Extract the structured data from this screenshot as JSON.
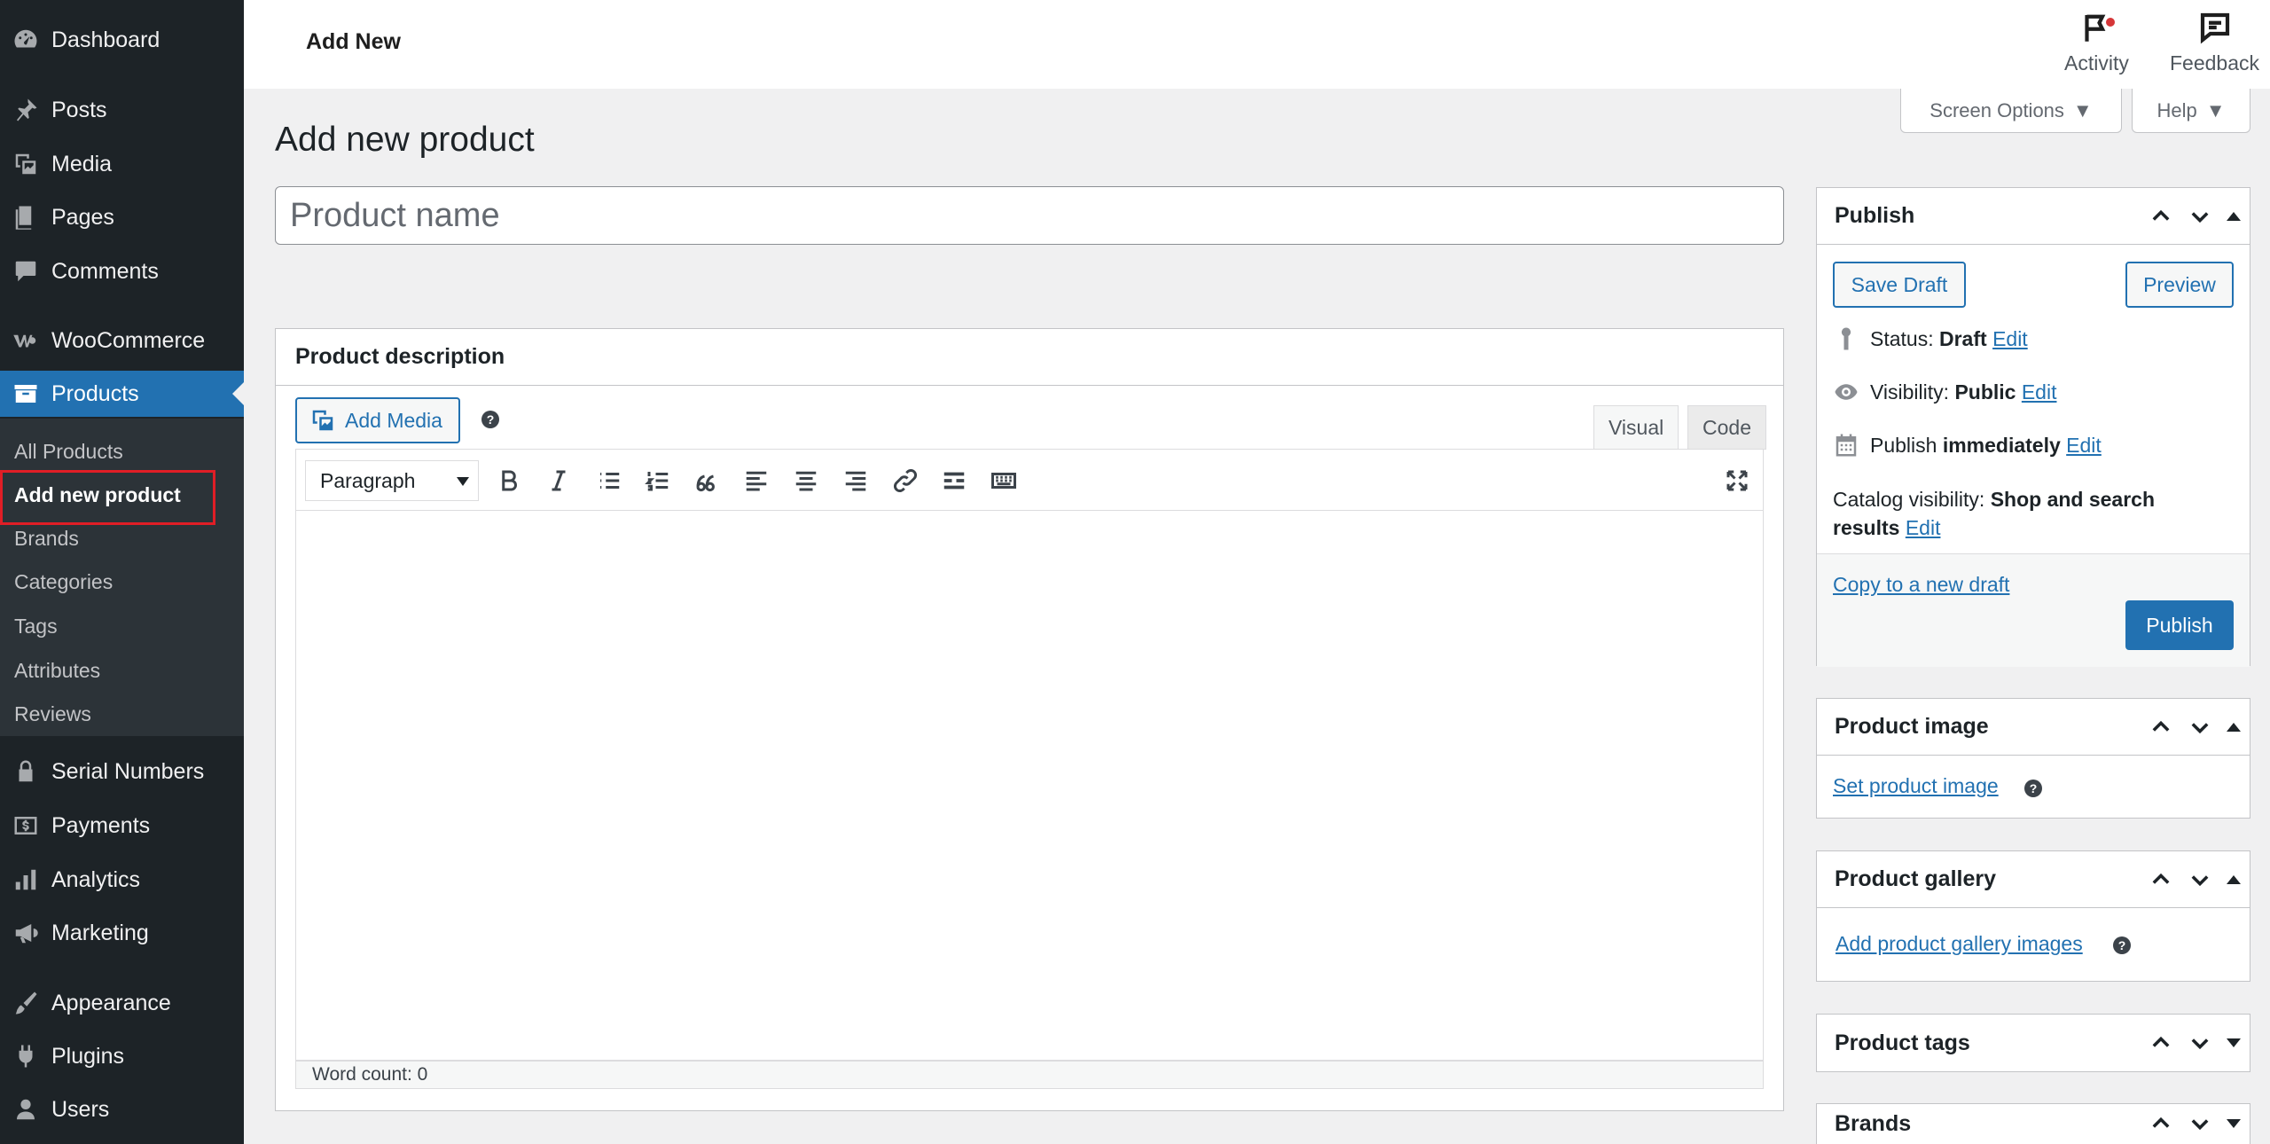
{
  "sidebar": {
    "items": [
      {
        "label": "Dashboard",
        "icon": "dashboard-icon"
      },
      {
        "label": "Posts",
        "icon": "pin-icon"
      },
      {
        "label": "Media",
        "icon": "media-icon"
      },
      {
        "label": "Pages",
        "icon": "pages-icon"
      },
      {
        "label": "Comments",
        "icon": "comment-icon"
      },
      {
        "label": "WooCommerce",
        "icon": "woocommerce-icon"
      },
      {
        "label": "Products",
        "icon": "archive-icon"
      },
      {
        "label": "Serial Numbers",
        "icon": "lock-icon"
      },
      {
        "label": "Payments",
        "icon": "dollar-icon"
      },
      {
        "label": "Analytics",
        "icon": "bar-chart-icon"
      },
      {
        "label": "Marketing",
        "icon": "megaphone-icon"
      },
      {
        "label": "Appearance",
        "icon": "brush-icon"
      },
      {
        "label": "Plugins",
        "icon": "plug-icon"
      },
      {
        "label": "Users",
        "icon": "user-icon"
      }
    ],
    "submenu": [
      "All Products",
      "Add new product",
      "Brands",
      "Categories",
      "Tags",
      "Attributes",
      "Reviews"
    ],
    "active_sub": "Add new product",
    "accent_color": "#2271b1",
    "highlight_color": "#e01e26"
  },
  "topbar": {
    "title": "Add New",
    "activity": "Activity",
    "feedback": "Feedback"
  },
  "screen_options": "Screen Options",
  "help": "Help",
  "page_title": "Add new product",
  "product_name_placeholder": "Product name",
  "description": {
    "title": "Product description",
    "add_media": "Add Media",
    "tab_visual": "Visual",
    "tab_code": "Code",
    "format": "Paragraph",
    "word_count": "Word count: 0"
  },
  "publish": {
    "title": "Publish",
    "save_draft": "Save Draft",
    "preview": "Preview",
    "status_label": "Status:",
    "status_value": "Draft",
    "visibility_label": "Visibility:",
    "visibility_value": "Public",
    "publish_label": "Publish",
    "publish_value": "immediately",
    "catalog_label": "Catalog visibility:",
    "catalog_value": "Shop and search results",
    "edit": "Edit",
    "copy_draft": "Copy to a new draft",
    "publish_button": "Publish"
  },
  "product_image": {
    "title": "Product image",
    "link": "Set product image"
  },
  "product_gallery": {
    "title": "Product gallery",
    "link": "Add product gallery images"
  },
  "product_tags": {
    "title": "Product tags"
  },
  "brands": {
    "title": "Brands"
  }
}
